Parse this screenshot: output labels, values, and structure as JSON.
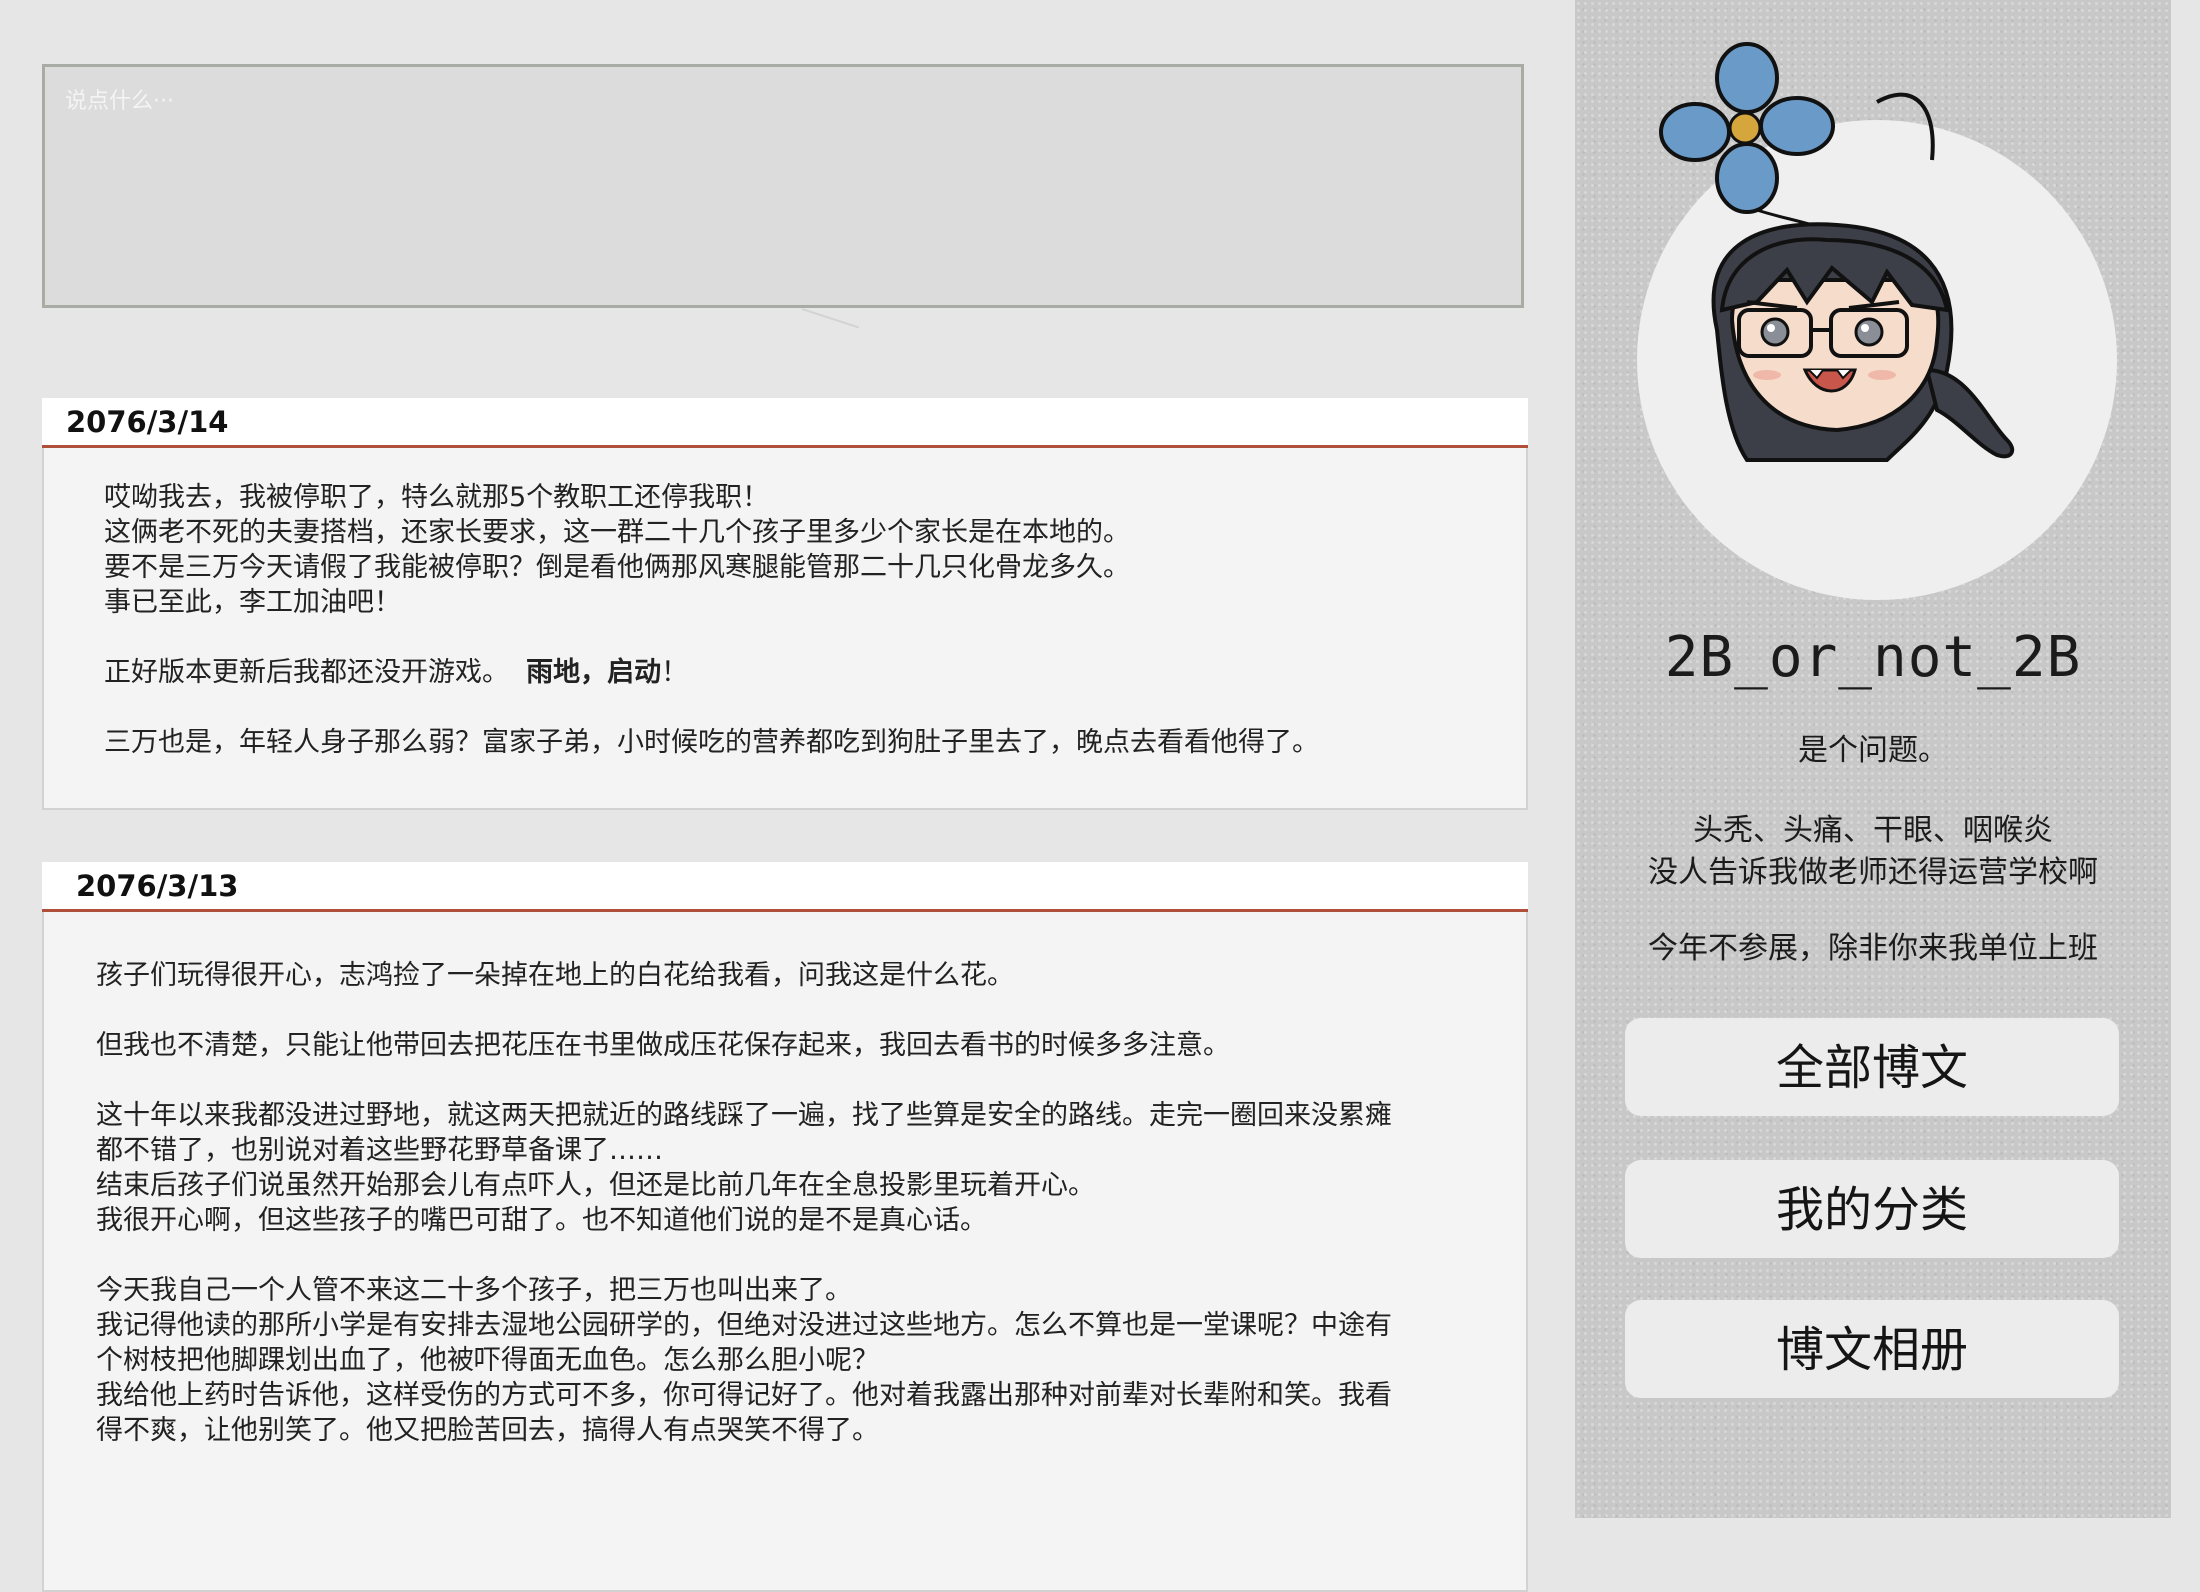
{
  "composer": {
    "placeholder": "说点什么···"
  },
  "posts": [
    {
      "date": "2076/3/14",
      "paragraphs": [
        [
          "哎呦我去，我被停职了，特么就那5个教职工还停我职！",
          "这俩老不死的夫妻搭档，还家长要求，这一群二十几个孩子里多少个家长是在本地的。",
          "要不是三万今天请假了我能被停职？倒是看他俩那风寒腿能管那二十几只化骨龙多久。",
          "事已至此，李工加油吧！"
        ],
        [
          "正好版本更新后我都还没开游戏。"
        ],
        [
          "三万也是，年轻人身子那么弱？富家子弟，小时候吃的营养都吃到狗肚子里去了，晚点去看看他得了。"
        ]
      ],
      "emphasis": "雨地，启动",
      "emphasis_suffix": "！"
    },
    {
      "date": "2076/3/13",
      "paragraphs": [
        [
          "孩子们玩得很开心，志鸿捡了一朵掉在地上的白花给我看，问我这是什么花。"
        ],
        [
          "但我也不清楚，只能让他带回去把花压在书里做成压花保存起来，我回去看书的时候多多注意。"
        ],
        [
          "这十年以来我都没进过野地，就这两天把就近的路线踩了一遍，找了些算是安全的路线。走完一圈回来没累瘫",
          "都不错了，也别说对着这些野花野草备课了……",
          "结束后孩子们说虽然开始那会儿有点吓人，但还是比前几年在全息投影里玩着开心。",
          "我很开心啊，但这些孩子的嘴巴可甜了。也不知道他们说的是不是真心话。"
        ],
        [
          "今天我自己一个人管不来这二十多个孩子，把三万也叫出来了。",
          "我记得他读的那所小学是有安排去湿地公园研学的，但绝对没进过这些地方。怎么不算也是一堂课呢？中途有",
          "个树枝把他脚踝划出血了，他被吓得面无血色。怎么那么胆小呢？",
          "我给他上药时告诉他，这样受伤的方式可不多，你可得记好了。他对着我露出那种对前辈对长辈附和笑。我看",
          "得不爽，让他别笑了。他又把脸苦回去，搞得人有点哭笑不得了。"
        ]
      ]
    }
  ],
  "profile": {
    "username": "2B_or_not_2B",
    "bio_line1": "是个问题。",
    "bio_lines2": [
      "头秃、头痛、干眼、咽喉炎",
      "没人告诉我做老师还得运营学校啊"
    ],
    "bio_line3": "今年不参展，除非你来我单位上班",
    "nav": [
      "全部博文",
      "我的分类",
      "博文相册"
    ]
  },
  "colors": {
    "accent": "#b0503a",
    "page_bg": "#e6e6e6",
    "sidebar_bg": "#c8c8c8",
    "flower": "#6a9bc8"
  }
}
